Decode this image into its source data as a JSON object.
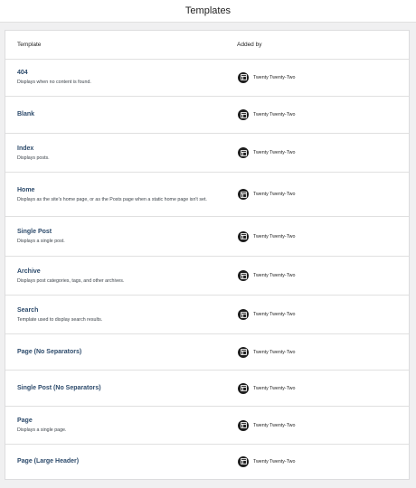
{
  "header": {
    "title": "Templates"
  },
  "table": {
    "columns": {
      "template": "Template",
      "added_by": "Added by"
    },
    "rows": [
      {
        "title": "404",
        "description": "Displays when no content is found.",
        "added_by": "Twenty Twenty-Two"
      },
      {
        "title": "Blank",
        "description": "",
        "added_by": "Twenty Twenty-Two"
      },
      {
        "title": "Index",
        "description": "Displays posts.",
        "added_by": "Twenty Twenty-Two"
      },
      {
        "title": "Home",
        "description": "Displays as the site's home page, or as the Posts page when a static home page isn't set.",
        "added_by": "Twenty Twenty-Two"
      },
      {
        "title": "Single Post",
        "description": "Displays a single post.",
        "added_by": "Twenty Twenty-Two"
      },
      {
        "title": "Archive",
        "description": "Displays post categories, tags, and other archives.",
        "added_by": "Twenty Twenty-Two"
      },
      {
        "title": "Search",
        "description": "Template used to display search results.",
        "added_by": "Twenty Twenty-Two"
      },
      {
        "title": "Page (No Separators)",
        "description": "",
        "added_by": "Twenty Twenty-Two"
      },
      {
        "title": "Single Post (No Separators)",
        "description": "",
        "added_by": "Twenty Twenty-Two"
      },
      {
        "title": "Page",
        "description": "Displays a single page.",
        "added_by": "Twenty Twenty-Two"
      },
      {
        "title": "Page (Large Header)",
        "description": "",
        "added_by": "Twenty Twenty-Two"
      }
    ]
  },
  "icons": {
    "theme": "layout-template-icon"
  },
  "colors": {
    "link": "#2c4a6b",
    "icon_bg": "#1e1e1e",
    "page_bg": "#f0f0f1"
  }
}
